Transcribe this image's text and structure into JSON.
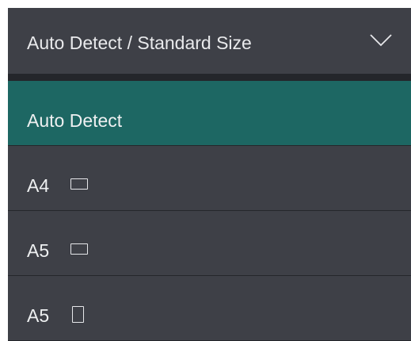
{
  "select": {
    "label": "Auto Detect / Standard Size",
    "icon": "chevron-down-icon"
  },
  "options": [
    {
      "label": "Auto Detect",
      "selected": true,
      "orientation": null
    },
    {
      "label": "A4",
      "selected": false,
      "orientation": "landscape-icon"
    },
    {
      "label": "A5",
      "selected": false,
      "orientation": "landscape-icon"
    },
    {
      "label": "A5",
      "selected": false,
      "orientation": "portrait-icon"
    }
  ],
  "colors": {
    "panel": "#3e4047",
    "selected": "#1d6763",
    "text": "#e9eaec"
  }
}
